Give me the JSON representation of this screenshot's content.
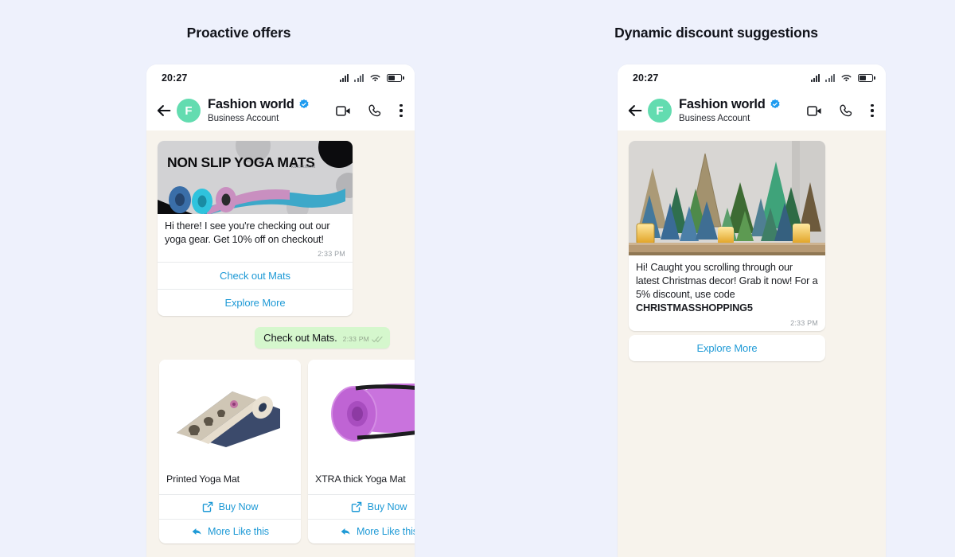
{
  "page": {
    "background": "#eef1fc"
  },
  "panels": [
    {
      "title": "Proactive offers",
      "status": {
        "time": "20:27"
      },
      "header": {
        "back_icon": "back-arrow-icon",
        "avatar_initial": "F",
        "avatar_color": "#63dcb0",
        "name": "Fashion world",
        "verified_icon": "verified-badge-icon",
        "verified_color": "#1d9bf0",
        "subtitle": "Business Account",
        "actions": [
          "video-call-icon",
          "voice-call-icon",
          "more-options-icon"
        ]
      },
      "messages": {
        "offer_card": {
          "image_alt": "NON SLIP YOGA MATS",
          "banner_text": "NON SLIP YOGA MATS",
          "text": "Hi there! I see you're checking out our yoga gear. Get 10% off on checkout!",
          "time": "2:33 PM",
          "actions": [
            "Check out Mats",
            "Explore More"
          ]
        },
        "outgoing": {
          "text": "Check out Mats.",
          "time": "2:33 PM",
          "status_icon": "double-check-icon",
          "bubble_color": "#d5f7cd"
        },
        "products": [
          {
            "name": "Printed Yoga Mat",
            "buy_label": "Buy Now",
            "buy_icon": "external-link-icon",
            "more_label": "More Like this",
            "more_icon": "reply-arrow-icon"
          },
          {
            "name": "XTRA thick Yoga Mat",
            "buy_label": "Buy Now",
            "buy_icon": "external-link-icon",
            "more_label": "More Like this",
            "more_icon": "reply-arrow-icon"
          }
        ]
      }
    },
    {
      "title": "Dynamic discount suggestions",
      "status": {
        "time": "20:27"
      },
      "header": {
        "back_icon": "back-arrow-icon",
        "avatar_initial": "F",
        "avatar_color": "#63dcb0",
        "name": "Fashion world",
        "verified_icon": "verified-badge-icon",
        "verified_color": "#1d9bf0",
        "subtitle": "Business Account",
        "actions": [
          "video-call-icon",
          "voice-call-icon",
          "more-options-icon"
        ]
      },
      "messages": {
        "offer_card": {
          "image_alt": "Miniature bottle-brush Christmas trees on a shelf with lit candles",
          "text": "Hi! Caught you scrolling through our latest Christmas decor! Grab it now! For a 5% discount, use code ",
          "promo_code": "CHRISTMASSHOPPING5",
          "time": "2:33 PM",
          "actions": [
            "Explore More"
          ]
        }
      }
    }
  ],
  "colors": {
    "link": "#1f9ad6",
    "chat_bg": "#f7f3ec",
    "card_bg": "#ffffff",
    "text": "#1b1d22"
  }
}
